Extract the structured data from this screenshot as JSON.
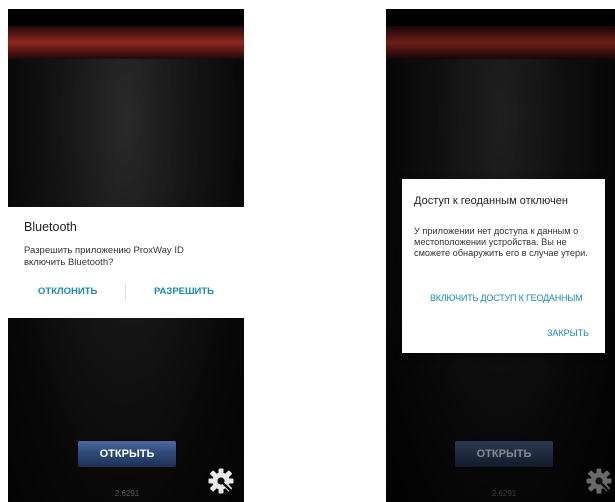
{
  "left_screen": {
    "dialog": {
      "title": "Bluetooth",
      "message": "Разрешить приложению ProxWay ID включить Bluetooth?",
      "deny_label": "ОТКЛОНИТЬ",
      "allow_label": "РАЗРЕШИТЬ"
    },
    "open_button_label": "ОТКРЫТЬ",
    "version": "2.6291"
  },
  "right_screen": {
    "dialog": {
      "title": "Доступ к геоданным отключен",
      "message": "У приложении нет доступа к данным о местоположении устройства. Вы не сможете обнаружить его в случае утери.",
      "enable_label": "ВКЛЮЧИТЬ ДОСТУП К ГЕОДАННЫМ",
      "close_label": "ЗАКРЫТЬ"
    },
    "open_button_label": "ОТКРЫТЬ",
    "version": "2.6291"
  },
  "colors": {
    "accent": "#1a8ab5",
    "red_band": "#c23a2c",
    "button_blue": "#2f4a78"
  },
  "icons": {
    "settings": "gear-icon"
  }
}
